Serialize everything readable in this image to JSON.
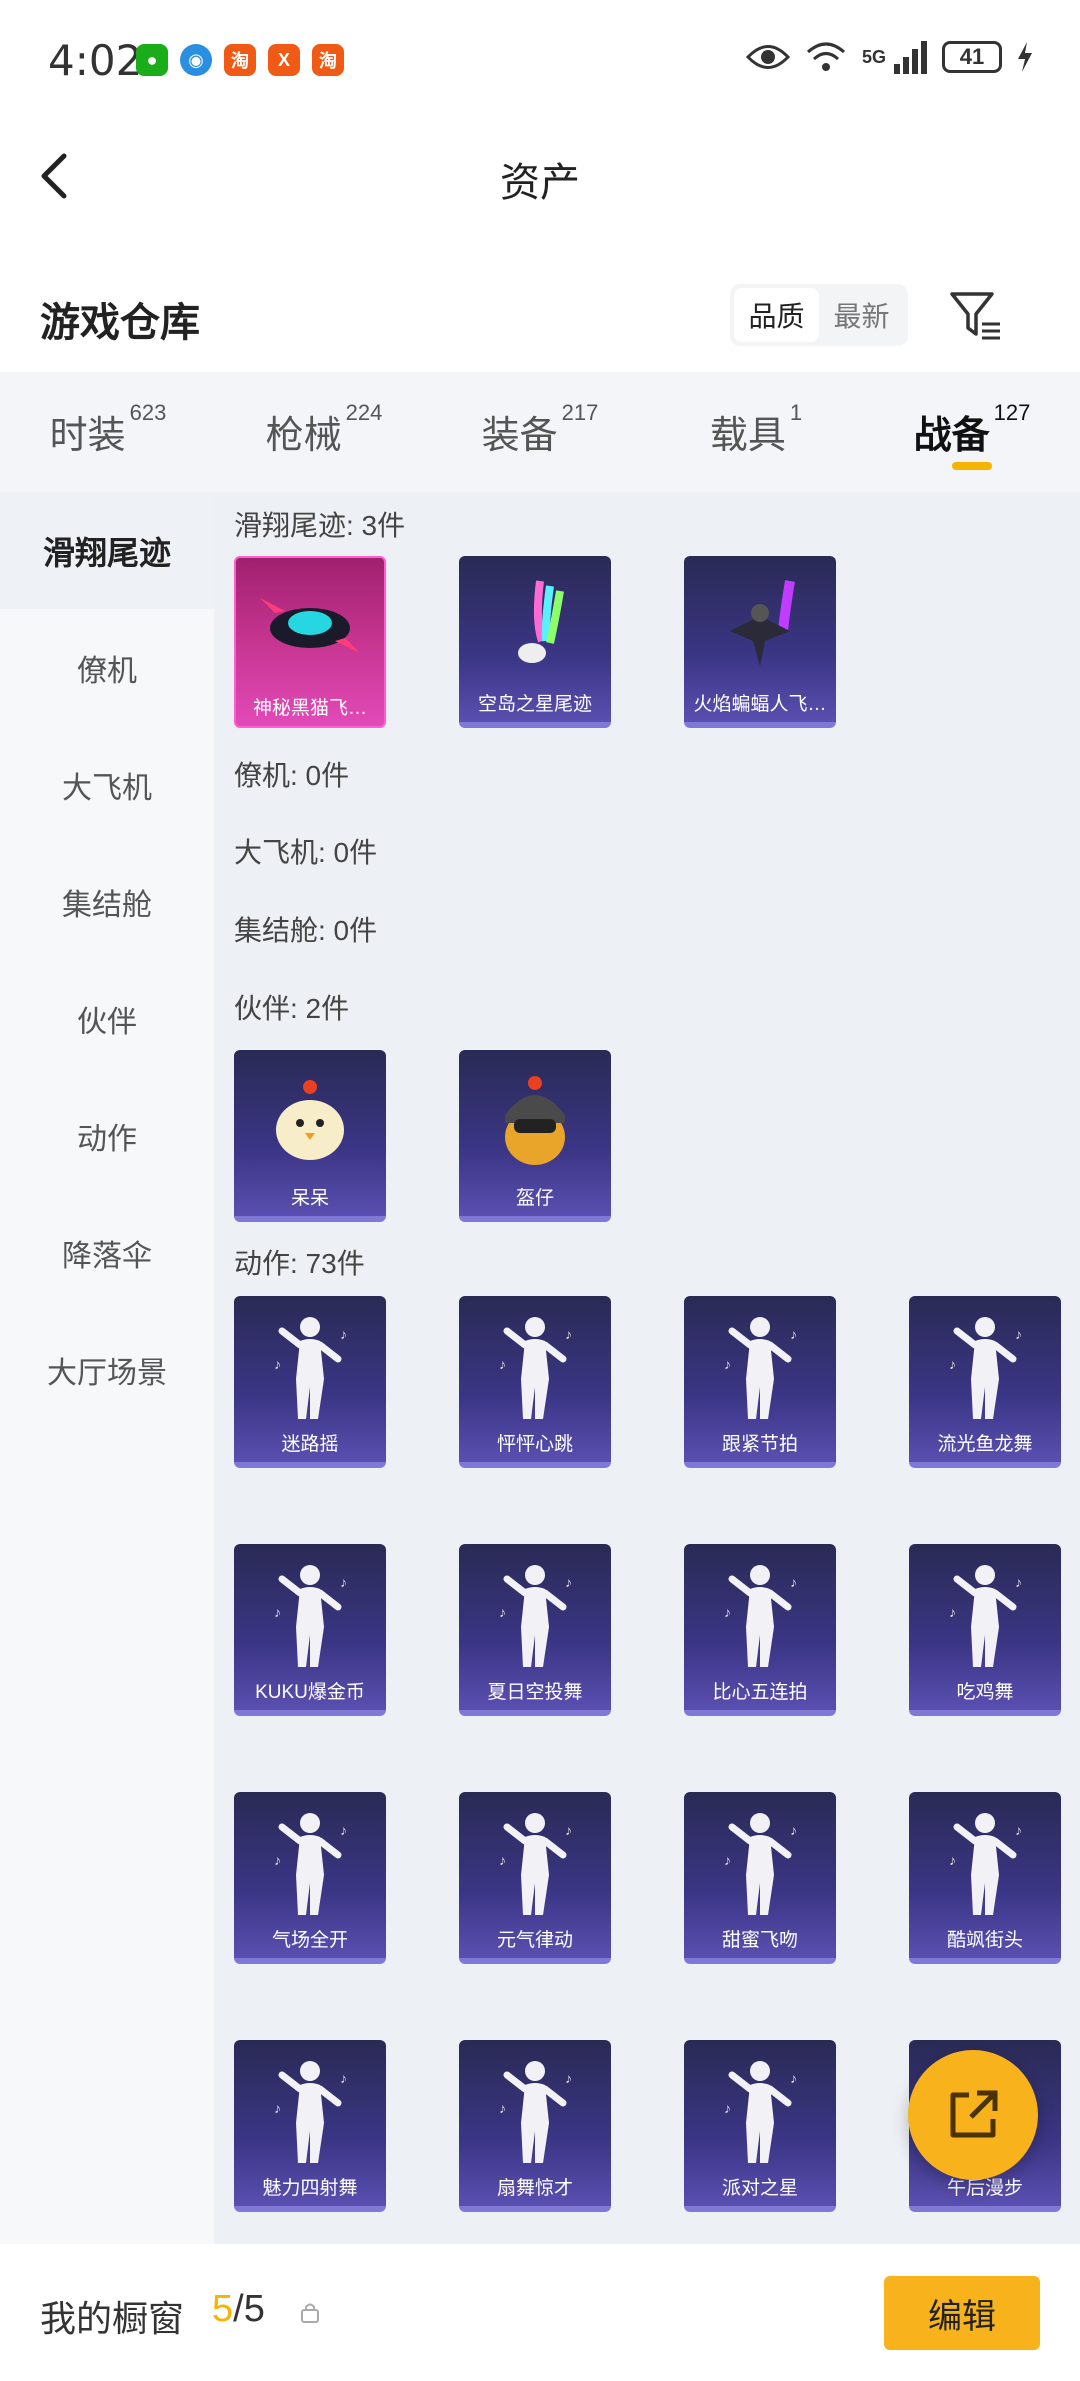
{
  "status_bar": {
    "time": "4:02",
    "network": "5G",
    "battery": "41"
  },
  "nav": {
    "title": "资产"
  },
  "warehouse": {
    "title": "游戏仓库",
    "sort_options": [
      "品质",
      "最新"
    ],
    "active_sort": "品质"
  },
  "tabs": [
    {
      "label": "时装",
      "count": "623"
    },
    {
      "label": "枪械",
      "count": "224"
    },
    {
      "label": "装备",
      "count": "217"
    },
    {
      "label": "载具",
      "count": "1"
    },
    {
      "label": "战备",
      "count": "127",
      "active": true
    }
  ],
  "sidebar": {
    "items": [
      "滑翔尾迹",
      "僚机",
      "大飞机",
      "集结舱",
      "伙伴",
      "动作",
      "降落伞",
      "大厅场景"
    ]
  },
  "sections": {
    "trail_title": "滑翔尾迹: 3件",
    "trail_items": [
      "神秘黑猫飞…",
      "空岛之星尾迹",
      "火焰蝙蝠人飞…"
    ],
    "wingman_title": "僚机: 0件",
    "plane_title": "大飞机: 0件",
    "pod_title": "集结舱: 0件",
    "partner_title": "伙伴: 2件",
    "partner_items": [
      "呆呆",
      "盔仔"
    ],
    "emote_title": "动作: 73件",
    "emote_items": [
      "迷路摇",
      "怦怦心跳",
      "跟紧节拍",
      "流光鱼龙舞",
      "KUKU爆金币",
      "夏日空投舞",
      "比心五连拍",
      "吃鸡舞",
      "气场全开",
      "元气律动",
      "甜蜜飞吻",
      "酷飒街头",
      "魅力四射舞",
      "扇舞惊才",
      "派对之星",
      "午后漫步"
    ]
  },
  "bottom": {
    "showcase_label": "我的橱窗",
    "showcase_used": "5",
    "showcase_sep": "/5",
    "edit_label": "编辑"
  },
  "colors": {
    "accent": "#f7b21c",
    "card_bg": "#3b3585",
    "card_highlight": "#e24ab8"
  }
}
